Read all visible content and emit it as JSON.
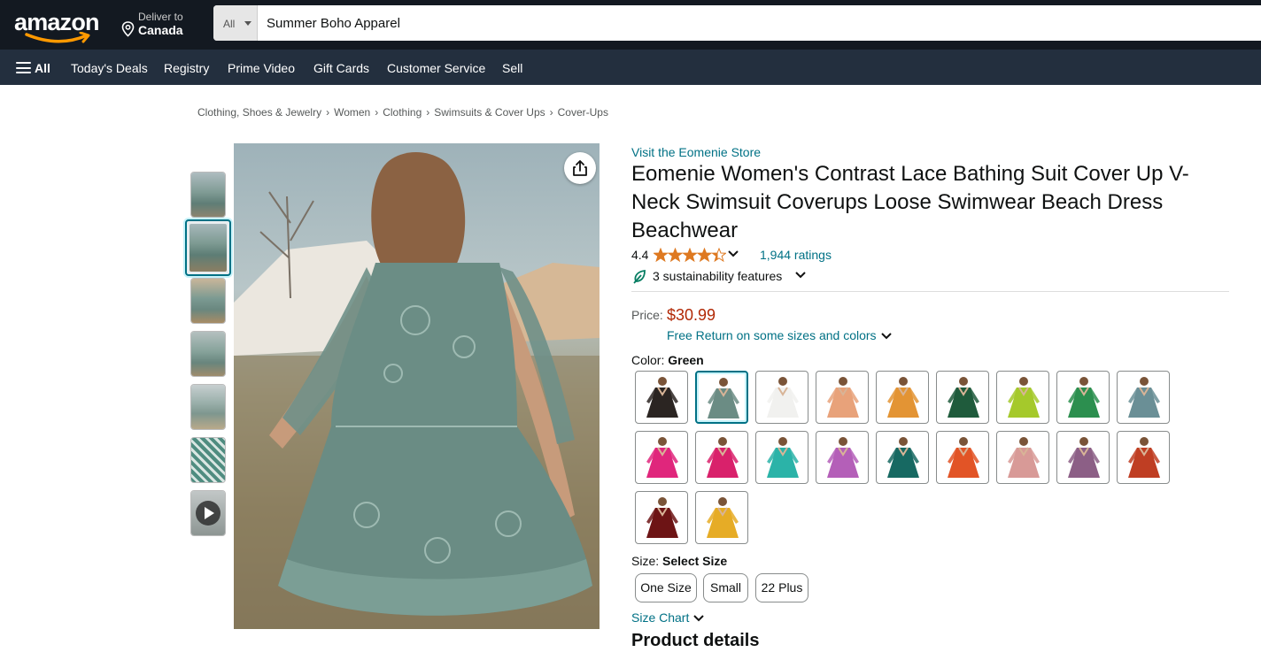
{
  "header": {
    "logo_text": "amazon",
    "deliver_to_label": "Deliver to",
    "deliver_to_location": "Canada",
    "search_category": "All",
    "search_value": "Summer Boho Apparel"
  },
  "nav": {
    "all_label": "All",
    "links": [
      "Today's Deals",
      "Registry",
      "Prime Video",
      "Gift Cards",
      "Customer Service",
      "Sell"
    ]
  },
  "breadcrumb": [
    "Clothing, Shoes & Jewelry",
    "Women",
    "Clothing",
    "Swimsuits & Cover Ups",
    "Cover-Ups"
  ],
  "gallery": {
    "thumbnails": [
      {
        "name": "thumb-1",
        "selected": false
      },
      {
        "name": "thumb-2",
        "selected": true
      },
      {
        "name": "thumb-3",
        "selected": false
      },
      {
        "name": "thumb-4",
        "selected": false
      },
      {
        "name": "thumb-5",
        "selected": false
      },
      {
        "name": "thumb-6",
        "selected": false
      },
      {
        "name": "thumb-video",
        "selected": false
      }
    ],
    "share_icon": "share-icon"
  },
  "product": {
    "store_link": "Visit the Eomenie Store",
    "title": "Eomenie Women's Contrast Lace Bathing Suit Cover Up V-Neck Swimsuit Coverups Loose Swimwear Beach Dress Beachwear",
    "rating": "4.4",
    "stars_fraction": 0.88,
    "ratings_count": "1,944 ratings",
    "sustainability": "3 sustainability features",
    "price_label": "Price:",
    "price": "$30.99",
    "free_return": "Free Return on some sizes and colors",
    "color_label": "Color:",
    "color_selected": "Green",
    "colors": [
      "#2b2522",
      "#6b8c84",
      "#f1f1ef",
      "#e8a27a",
      "#e39434",
      "#1f5b3c",
      "#a5c92b",
      "#2c8f4f",
      "#6a8f96",
      "#e0267c",
      "#d9216b",
      "#2bb3a8",
      "#b45fb8",
      "#176962",
      "#e25426",
      "#d89a97",
      "#8c5f86",
      "#bf3e23",
      "#6d1415",
      "#e6ac26"
    ],
    "selected_color_index": 1,
    "size_label": "Size:",
    "size_prompt": "Select Size",
    "sizes": [
      "One Size",
      "Small",
      "22 Plus"
    ],
    "size_chart": "Size Chart",
    "details_heading": "Product details"
  }
}
